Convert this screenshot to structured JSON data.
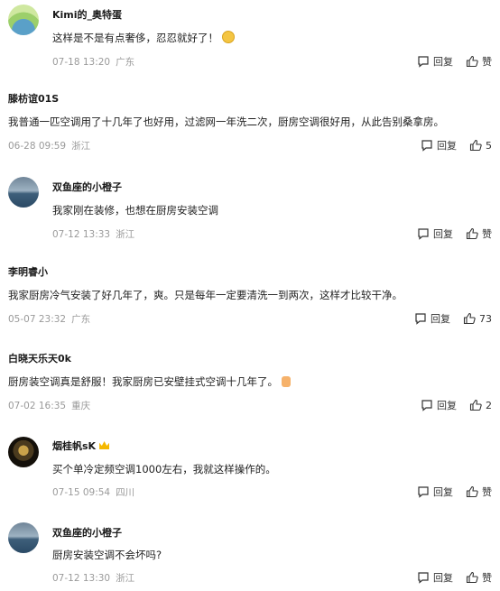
{
  "comments": [
    {
      "name": "Kimi的_奥特蛋",
      "text": "这样是不是有点奢侈，忍忍就好了！",
      "date": "07-18 13:20",
      "location": "广东",
      "reply": "回复",
      "like": "赞"
    },
    {
      "name": "滕枋谊01S",
      "text": "我普通一匹空调用了十几年了也好用，过滤网一年洗二次，厨房空调很好用，从此告别桑拿房。",
      "date": "06-28 09:59",
      "location": "浙江",
      "reply": "回复",
      "like": "5"
    },
    {
      "name": "双鱼座的小橙子",
      "text": "我家刚在装修，也想在厨房安装空调",
      "date": "07-12 13:33",
      "location": "浙江",
      "reply": "回复",
      "like": "赞"
    },
    {
      "name": "李明睿小",
      "text": "我家厨房冷气安装了好几年了，爽。只是每年一定要清洗一到两次，这样才比较干净。",
      "date": "05-07 23:32",
      "location": "广东",
      "reply": "回复",
      "like": "73"
    },
    {
      "name": "白晓天乐天0k",
      "text": "厨房装空调真是舒服！我家厨房已安壁挂式空调十几年了。",
      "date": "07-02 16:35",
      "location": "重庆",
      "reply": "回复",
      "like": "2"
    },
    {
      "name": "烟桂帆sK",
      "text": "买个单冷定频空调1000左右，我就这样操作的。",
      "date": "07-15 09:54",
      "location": "四川",
      "reply": "回复",
      "like": "赞"
    },
    {
      "name": "双鱼座的小橙子",
      "text": "厨房安装空调不会坏吗?",
      "date": "07-12 13:30",
      "location": "浙江",
      "reply": "回复",
      "like": "赞"
    }
  ]
}
